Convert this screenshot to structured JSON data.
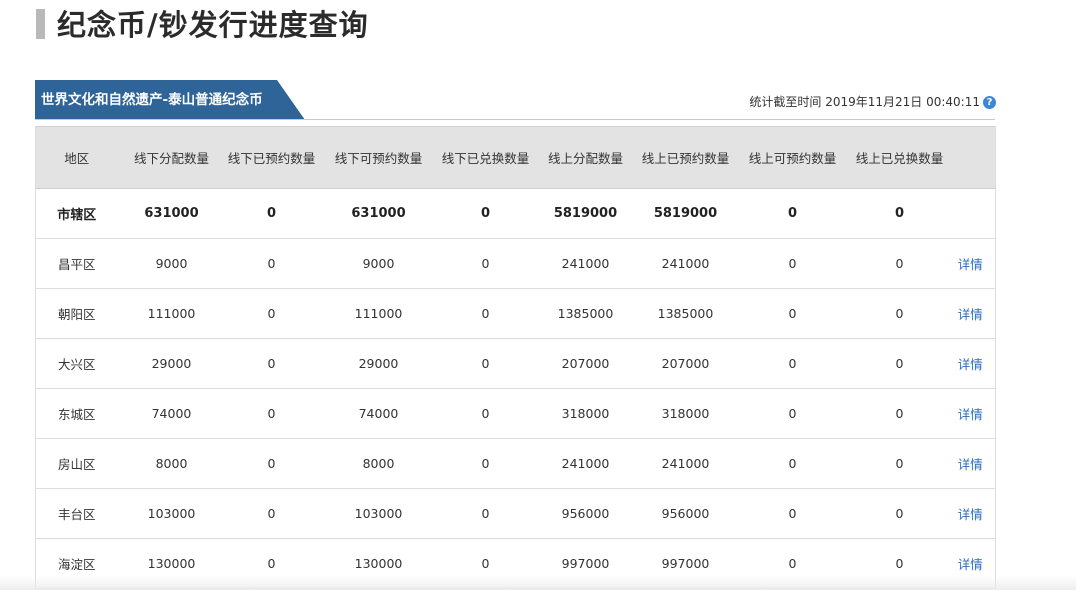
{
  "page": {
    "title": "纪念币/钞发行进度查询"
  },
  "coin_tab": {
    "label": "世界文化和自然遗产-泰山普通纪念币",
    "color": "#2f6499"
  },
  "stats": {
    "time_text": "统计截至时间 2019年11月21日 00:40:11",
    "help_icon": "question-circle-icon"
  },
  "table": {
    "headers": [
      "地区",
      "线下分配数量",
      "线下已预约数量",
      "线下可预约数量",
      "线下已兑换数量",
      "线上分配数量",
      "线上已预约数量",
      "线上可预约数量",
      "线上已兑换数量",
      ""
    ],
    "total_row": {
      "region": "市辖区",
      "values": [
        "631000",
        "0",
        "631000",
        "0",
        "5819000",
        "5819000",
        "0",
        "0"
      ]
    },
    "rows": [
      {
        "region": "昌平区",
        "values": [
          "9000",
          "0",
          "9000",
          "0",
          "241000",
          "241000",
          "0",
          "0"
        ],
        "link": "详情"
      },
      {
        "region": "朝阳区",
        "values": [
          "111000",
          "0",
          "111000",
          "0",
          "1385000",
          "1385000",
          "0",
          "0"
        ],
        "link": "详情"
      },
      {
        "region": "大兴区",
        "values": [
          "29000",
          "0",
          "29000",
          "0",
          "207000",
          "207000",
          "0",
          "0"
        ],
        "link": "详情"
      },
      {
        "region": "东城区",
        "values": [
          "74000",
          "0",
          "74000",
          "0",
          "318000",
          "318000",
          "0",
          "0"
        ],
        "link": "详情"
      },
      {
        "region": "房山区",
        "values": [
          "8000",
          "0",
          "8000",
          "0",
          "241000",
          "241000",
          "0",
          "0"
        ],
        "link": "详情"
      },
      {
        "region": "丰台区",
        "values": [
          "103000",
          "0",
          "103000",
          "0",
          "956000",
          "956000",
          "0",
          "0"
        ],
        "link": "详情"
      },
      {
        "region": "海淀区",
        "values": [
          "130000",
          "0",
          "130000",
          "0",
          "997000",
          "997000",
          "0",
          "0"
        ],
        "link": "详情"
      }
    ],
    "link_color": "#2a6bbf"
  }
}
